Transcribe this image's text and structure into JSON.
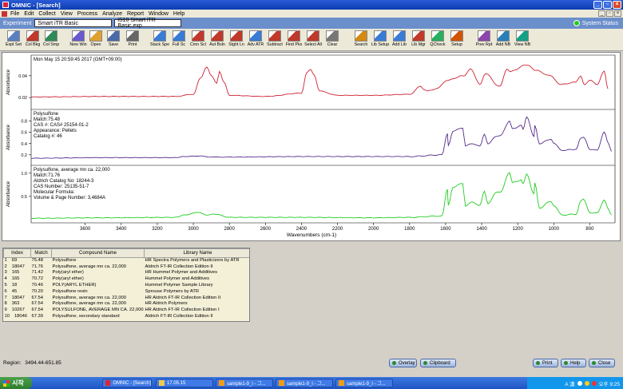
{
  "window": {
    "title": "OMNIC - [Search]"
  },
  "menu": [
    "File",
    "Edit",
    "Collect",
    "View",
    "Process",
    "Analyze",
    "Report",
    "Window",
    "Help"
  ],
  "experiment": {
    "label": "Experiment",
    "name": "Smart iTR Basic",
    "config": "iS10 Smart iTR Basic.exp",
    "status": "System Status",
    "status_color": "#22cc22"
  },
  "toolbar": [
    {
      "label": "Expt Set",
      "icon": "experiment-setup-icon"
    },
    {
      "label": "Col Bkg",
      "icon": "collect-background-icon"
    },
    {
      "label": "Col Smp",
      "icon": "collect-sample-icon"
    },
    {
      "label": "New Win",
      "icon": "new-window-icon"
    },
    {
      "label": "Open",
      "icon": "open-folder-icon"
    },
    {
      "label": "Save",
      "icon": "save-disk-icon"
    },
    {
      "label": "Print",
      "icon": "printer-icon"
    },
    {
      "label": "Stack Spe",
      "icon": "stack-spectra-icon"
    },
    {
      "label": "Full Sc",
      "icon": "full-scale-icon"
    },
    {
      "label": "Cmn Scl",
      "icon": "common-scale-icon"
    },
    {
      "label": "Aut Bsln",
      "icon": "auto-baseline-icon"
    },
    {
      "label": "Stght Ln",
      "icon": "straight-line-icon"
    },
    {
      "label": "Adv ATR",
      "icon": "advanced-atr-icon"
    },
    {
      "label": "Subtract",
      "icon": "subtract-icon"
    },
    {
      "label": "Find Pks",
      "icon": "find-peaks-icon"
    },
    {
      "label": "Select All",
      "icon": "select-all-icon"
    },
    {
      "label": "Clear",
      "icon": "clear-icon"
    },
    {
      "label": "Search",
      "icon": "search-icon"
    },
    {
      "label": "Lib Setup",
      "icon": "library-setup-icon"
    },
    {
      "label": "Add Lib",
      "icon": "add-library-icon"
    },
    {
      "label": "Lib Mgr",
      "icon": "library-manager-icon"
    },
    {
      "label": "QCheck",
      "icon": "qcheck-icon"
    },
    {
      "label": "Setup",
      "icon": "setup-icon"
    },
    {
      "label": "Prev Rpt",
      "icon": "preview-report-icon"
    },
    {
      "label": "Add NB",
      "icon": "add-notebook-icon"
    },
    {
      "label": "View NB",
      "icon": "view-notebook-icon"
    }
  ],
  "spectra": {
    "ylabel": "Absorbance",
    "xlabel": "Wavenumbers (cm-1)",
    "xticks": [
      "3600",
      "3400",
      "3200",
      "3000",
      "2800",
      "2600",
      "2400",
      "2200",
      "2000",
      "1800",
      "1600",
      "1400",
      "1200",
      "1000",
      "800"
    ],
    "panels": [
      {
        "color": "#cc2233",
        "header": [
          "Mon May 15 20:59:45 2017 (GMT+09:00)"
        ],
        "yticks": [
          "0.04",
          "0.02"
        ]
      },
      {
        "color": "#552a8a",
        "header": [
          "Polysulfone",
          "Match:75.48",
          "CAS #:  CAS# 25154-01-2",
          "Appearance:  Pellets",
          "Catalog #:  46"
        ],
        "yticks": [
          "0.8",
          "0.6",
          "0.4",
          "0.2"
        ]
      },
      {
        "color": "#22cc22",
        "header": [
          "Polysulfone, average mn ca. 22,000",
          "Match:71.76",
          "Aldrich Catalog No:  18244-3",
          "CAS Number:  25135-51-7",
          "Molecular Formula:",
          "Volume & Page Number:  3,4684A"
        ],
        "yticks": [
          "1.0",
          "0.5"
        ]
      }
    ]
  },
  "chart_data": {
    "type": "line",
    "xlabel": "Wavenumbers (cm-1)",
    "ylabel": "Absorbance",
    "xlim": [
      3900,
      660
    ],
    "series": [
      {
        "name": "Sample (Mon May 15 20:59:45 2017)",
        "ylim": [
          0.012,
          0.056
        ],
        "x": [
          3900,
          3500,
          3100,
          3000,
          2960,
          2925,
          2900,
          2870,
          2855,
          2830,
          2800,
          2600,
          2400,
          2370,
          2350,
          2330,
          2300,
          2200,
          2000,
          1800,
          1740,
          1720,
          1700,
          1650,
          1590,
          1500,
          1460,
          1410,
          1380,
          1300,
          1260,
          1240,
          1150,
          1100,
          1020,
          960,
          880,
          850,
          830,
          800,
          760,
          720,
          700
        ],
        "y": [
          0.0205,
          0.021,
          0.021,
          0.023,
          0.038,
          0.048,
          0.04,
          0.033,
          0.044,
          0.034,
          0.022,
          0.021,
          0.024,
          0.043,
          0.046,
          0.041,
          0.026,
          0.022,
          0.022,
          0.023,
          0.03,
          0.027,
          0.026,
          0.028,
          0.036,
          0.04,
          0.046,
          0.032,
          0.042,
          0.03,
          0.046,
          0.044,
          0.05,
          0.045,
          0.04,
          0.032,
          0.034,
          0.04,
          0.032,
          0.036,
          0.032,
          0.044,
          0.028
        ]
      },
      {
        "name": "Polysulfone",
        "ylim": [
          0.07,
          0.95
        ],
        "x": [
          3900,
          3500,
          3100,
          3050,
          2970,
          2900,
          2800,
          2400,
          2000,
          1800,
          1620,
          1590,
          1585,
          1560,
          1505,
          1490,
          1450,
          1410,
          1385,
          1365,
          1320,
          1295,
          1245,
          1230,
          1180,
          1170,
          1150,
          1110,
          1105,
          1080,
          1015,
          1000,
          955,
          875,
          850,
          835,
          800,
          760,
          720,
          695,
          680
        ],
        "y": [
          0.14,
          0.15,
          0.15,
          0.17,
          0.18,
          0.16,
          0.16,
          0.17,
          0.17,
          0.17,
          0.2,
          0.58,
          0.36,
          0.62,
          0.68,
          0.36,
          0.4,
          0.35,
          0.57,
          0.4,
          0.52,
          0.55,
          0.8,
          0.66,
          0.72,
          0.66,
          0.88,
          0.52,
          0.72,
          0.4,
          0.48,
          0.4,
          0.28,
          0.3,
          0.5,
          0.52,
          0.3,
          0.28,
          0.6,
          0.4,
          0.26
        ]
      },
      {
        "name": "Polysulfone, average mn ca. 22,000",
        "ylim": [
          0.0,
          1.1
        ],
        "x": [
          3900,
          3500,
          3100,
          3050,
          2970,
          2930,
          2880,
          2800,
          2400,
          2000,
          1800,
          1620,
          1590,
          1585,
          1560,
          1505,
          1490,
          1450,
          1410,
          1385,
          1365,
          1320,
          1295,
          1245,
          1230,
          1180,
          1170,
          1150,
          1110,
          1105,
          1080,
          1015,
          1000,
          955,
          875,
          850,
          835,
          800,
          760,
          720,
          695,
          680
        ],
        "y": [
          0.03,
          0.04,
          0.05,
          0.1,
          0.16,
          0.1,
          0.12,
          0.05,
          0.05,
          0.04,
          0.05,
          0.08,
          0.65,
          0.3,
          0.7,
          0.78,
          0.3,
          0.38,
          0.3,
          0.62,
          0.35,
          0.58,
          0.6,
          1.02,
          0.8,
          0.85,
          0.78,
          0.98,
          0.55,
          0.8,
          0.25,
          0.4,
          0.3,
          0.1,
          0.12,
          0.4,
          0.45,
          0.15,
          0.14,
          0.42,
          0.22,
          0.1
        ]
      }
    ]
  },
  "library_results": {
    "columns": [
      "Index",
      "Match",
      "Compound Name",
      "Library Name"
    ],
    "rows": [
      [
        "1",
        "69",
        "75.48",
        "Polysulfone",
        "HR Spectra Polymers and Plasticizers by ATR"
      ],
      [
        "2",
        "18047",
        "71.76",
        "Polysulfone, average mn ca. 22,000",
        "Aldrich FT-IR Collection Edition II"
      ],
      [
        "3",
        "165",
        "71.42",
        "Poly(aryl ether)",
        "HR Hummel Polymer and Additives"
      ],
      [
        "4",
        "165",
        "70.72",
        "Poly(aryl ether)",
        "Hummel Polymer and Additives"
      ],
      [
        "5",
        "18",
        "70.46",
        "POLY(ARYL ETHER)",
        "Hummel Polymer Sample Library"
      ],
      [
        "6",
        "45",
        "70.20",
        "Polysulfone resin",
        "Sprouse Polymers by ATR"
      ],
      [
        "7",
        "18047",
        "67.54",
        "Polysulfone, average mn ca. 22,000",
        "HR Aldrich FT-IR Collection Edition II"
      ],
      [
        "8",
        "363",
        "67.54",
        "Polysulfone, average mn ca. 22,000",
        "HR Aldrich Polymers"
      ],
      [
        "9",
        "10267",
        "67.54",
        "POLYSULFONE, AVERAGE MN CA. 22,000",
        "HR Aldrich FT-IR Collection Edition I"
      ],
      [
        "10",
        "18046",
        "67.39",
        "Polysulfone, secondary standard",
        "Aldrich FT-IR Collection Edition II"
      ]
    ]
  },
  "status": {
    "region_label": "Region:",
    "region_value": "3494.44-651.85"
  },
  "buttons": {
    "overlay": "Overlay",
    "clipboard": "Clipboard",
    "print": "Print",
    "help": "Help",
    "close": "Close"
  },
  "taskbar": {
    "start": "시작",
    "tasks": [
      "OMNIC - [Search]",
      "17.05.15",
      "sample1-9_l - 그...",
      "sample1-9_l - 그...",
      "sample1-9_l - 그..."
    ],
    "tray_lang": "A 漢",
    "clock": "오후 9:25"
  }
}
